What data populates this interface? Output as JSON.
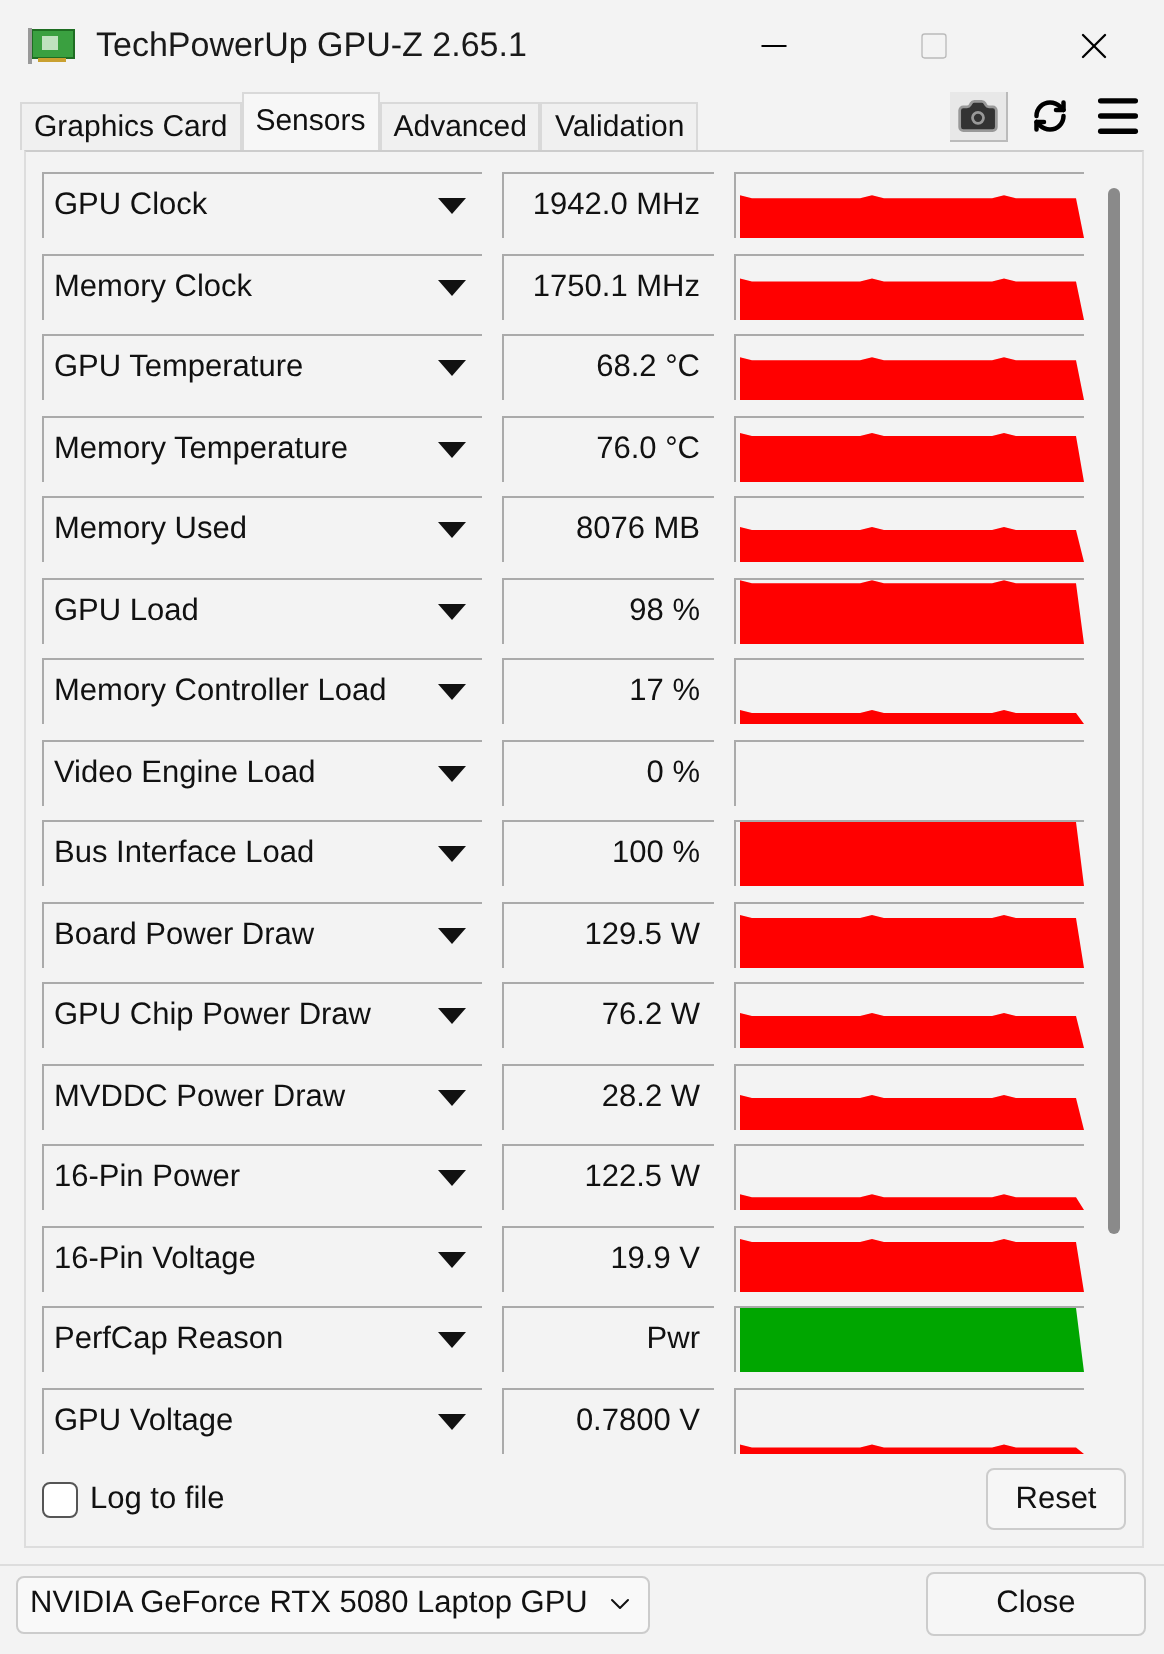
{
  "window": {
    "title": "TechPowerUp GPU-Z 2.65.1"
  },
  "tabs": [
    {
      "label": "Graphics Card",
      "selected": false
    },
    {
      "label": "Sensors",
      "selected": true
    },
    {
      "label": "Advanced",
      "selected": false
    },
    {
      "label": "Validation",
      "selected": false
    }
  ],
  "sensors": [
    {
      "name": "GPU Clock",
      "value": "1942.0 MHz",
      "color": "#ff0000"
    },
    {
      "name": "Memory Clock",
      "value": "1750.1 MHz",
      "color": "#ff0000"
    },
    {
      "name": "GPU Temperature",
      "value": "68.2 °C",
      "color": "#ff0000"
    },
    {
      "name": "Memory Temperature",
      "value": "76.0 °C",
      "color": "#ff0000"
    },
    {
      "name": "Memory Used",
      "value": "8076 MB",
      "color": "#ff0000"
    },
    {
      "name": "GPU Load",
      "value": "98 %",
      "color": "#ff0000"
    },
    {
      "name": "Memory Controller Load",
      "value": "17 %",
      "color": "#ff0000"
    },
    {
      "name": "Video Engine Load",
      "value": "0 %"
    },
    {
      "name": "Bus Interface Load",
      "value": "100 %",
      "color": "#ff0000"
    },
    {
      "name": "Board Power Draw",
      "value": "129.5 W",
      "color": "#ff0000"
    },
    {
      "name": "GPU Chip Power Draw",
      "value": "76.2 W",
      "color": "#ff0000"
    },
    {
      "name": "MVDDC Power Draw",
      "value": "28.2 W",
      "color": "#ff0000"
    },
    {
      "name": "16-Pin Power",
      "value": "122.5 W",
      "color": "#ff0000"
    },
    {
      "name": "16-Pin Voltage",
      "value": "19.9 V",
      "color": "#ff0000"
    },
    {
      "name": "PerfCap Reason",
      "value": "Pwr",
      "color": "#00a600"
    },
    {
      "name": "GPU Voltage",
      "value": "0.7800 V",
      "color": "#ff0000"
    }
  ],
  "log_to_file": {
    "label": "Log to file",
    "checked": false
  },
  "reset_button": "Reset",
  "gpu_select": {
    "value": "NVIDIA GeForce RTX 5080 Laptop GPU"
  },
  "close_button": "Close"
}
